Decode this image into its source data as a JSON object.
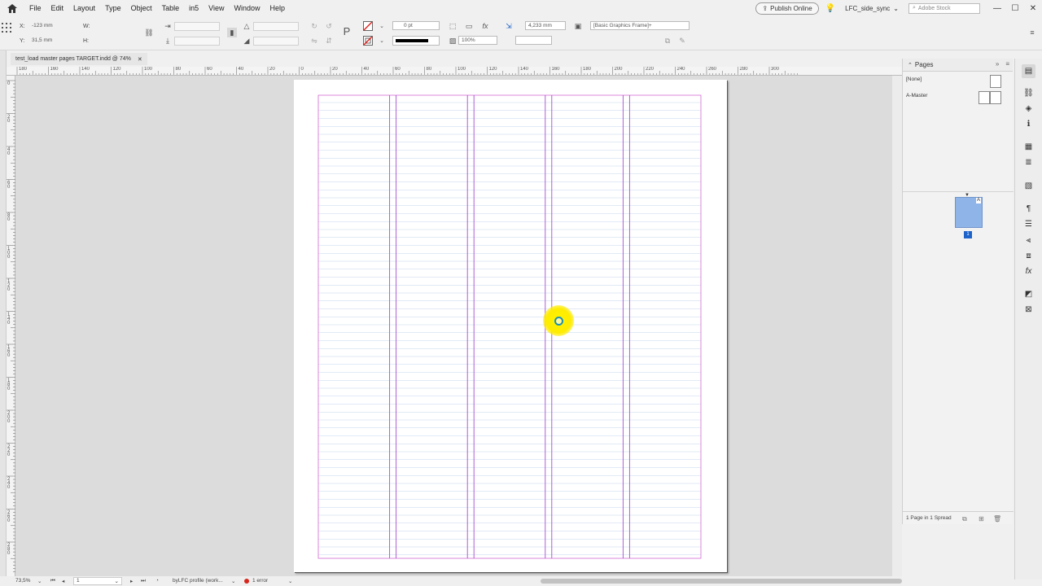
{
  "menubar": {
    "items": [
      "File",
      "Edit",
      "Layout",
      "Type",
      "Object",
      "Table",
      "in5",
      "View",
      "Window",
      "Help"
    ],
    "publish_label": "Publish Online",
    "workspace": "LFC_side_sync",
    "stock_placeholder": "Adobe Stock",
    "window_controls": [
      "—",
      "☐",
      "✕"
    ]
  },
  "controlbar": {
    "x_label": "X:",
    "x_value": "-123 mm",
    "y_label": "Y:",
    "y_value": "31,5 mm",
    "w_label": "W:",
    "h_label": "H:",
    "stroke_weight": "0 pt",
    "opacity": "100%",
    "gap_value": "4,233 mm",
    "object_style": "[Basic Graphics Frame]+"
  },
  "document_tab": {
    "title": "test_load master pages TARGET.indd @ 74%",
    "close": "✕"
  },
  "ruler_h_labels": [
    "180",
    "160",
    "140",
    "120",
    "100",
    "80",
    "60",
    "40",
    "20",
    "0",
    "20",
    "40",
    "60",
    "80",
    "100",
    "120",
    "140",
    "160",
    "180",
    "200",
    "220",
    "240",
    "260",
    "280",
    "300"
  ],
  "ruler_v_labels": [
    "0",
    "2 0",
    "4 0",
    "6 0",
    "8 0",
    "1 0 0",
    "1 2 0",
    "1 4 0",
    "1 6 0",
    "1 8 0",
    "2 0 0",
    "2 2 0",
    "2 4 0",
    "2 6 0",
    "2 8 0"
  ],
  "guides": {
    "margin_color": "#d36ad3",
    "column_color": "#a64fd0",
    "baseline_color": "#c4d6ec"
  },
  "pages_panel": {
    "title": "Pages",
    "masters": [
      {
        "label": "[None]"
      },
      {
        "label": "A-Master"
      }
    ],
    "page_master_prefix": "A",
    "page_number": "1",
    "footer": "1 Page in 1 Spread",
    "page_color": "#8fb4e8",
    "page_number_color": "#1d63c9"
  },
  "status": {
    "zoom": "73,5%",
    "page": "1",
    "profile": "byLFC profile (work...",
    "errors": "1 error",
    "error_color": "#d9261c"
  },
  "dock_icons": [
    "pages-icon",
    "links-icon",
    "layers-icon",
    "info-icon",
    "swatches-icon",
    "stroke-icon",
    "color-icon",
    "paragraph-styles-icon",
    "character-styles-icon",
    "align-icon",
    "pathfinder-icon",
    "effects-icon",
    "gradient-icon",
    "text-wrap-icon"
  ]
}
